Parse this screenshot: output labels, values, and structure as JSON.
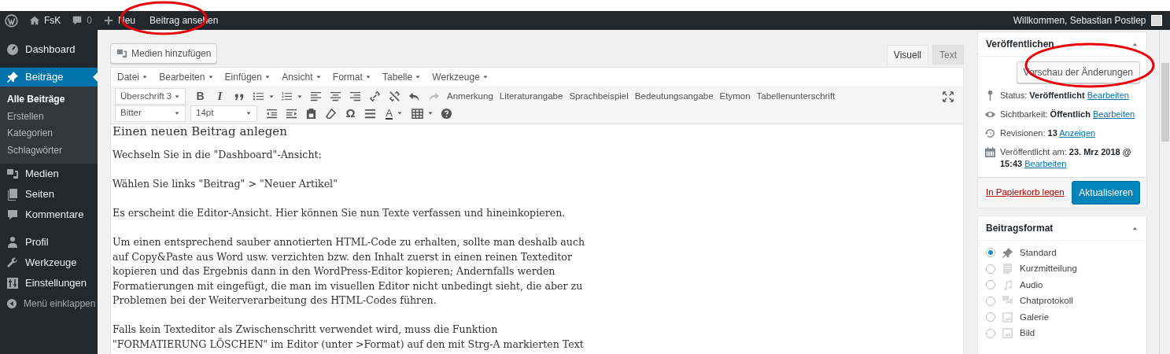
{
  "admin_bar": {
    "items": [
      {
        "kind": "logo"
      },
      {
        "kind": "site",
        "label": "FsK"
      },
      {
        "kind": "comments",
        "label": "0"
      },
      {
        "kind": "new",
        "label": "Neu"
      },
      {
        "kind": "view",
        "label": "Beitrag ansehen"
      }
    ],
    "greeting": "Willkommen, Sebastian Postlep"
  },
  "sidebar": {
    "items": [
      {
        "kind": "dashboard",
        "label": "Dashboard",
        "selected": false
      },
      {
        "kind": "posts",
        "label": "Beiträge",
        "selected": true,
        "children": [
          {
            "label": "Alle Beiträge",
            "selected": true
          },
          {
            "label": "Erstellen",
            "selected": false
          },
          {
            "label": "Kategorien",
            "selected": false
          },
          {
            "label": "Schlagwörter",
            "selected": false
          }
        ]
      },
      {
        "kind": "media",
        "label": "Medien",
        "selected": false
      },
      {
        "kind": "pages",
        "label": "Seiten",
        "selected": false
      },
      {
        "kind": "comments",
        "label": "Kommentare",
        "selected": false
      },
      {
        "kind": "profile",
        "label": "Profil",
        "selected": false
      },
      {
        "kind": "tools",
        "label": "Werkzeuge",
        "selected": false
      },
      {
        "kind": "settings",
        "label": "Einstellungen",
        "selected": false
      }
    ],
    "collapse_label": "Menü einklappen"
  },
  "editor": {
    "add_media_button": "Medien hinzufügen",
    "tabs": [
      {
        "label": "Visuell",
        "selected": true
      },
      {
        "label": "Text",
        "selected": false
      }
    ],
    "menubar": [
      "Datei",
      "Bearbeiten",
      "Einfügen",
      "Ansicht",
      "Format",
      "Tabelle",
      "Werkzeuge"
    ],
    "format_select": "Überschrift 3",
    "font_select": "Bitter",
    "size_select": "14pt",
    "toolbar_1": [
      {
        "kind": "bold",
        "label": "B"
      },
      {
        "kind": "italic",
        "label": "I"
      },
      {
        "kind": "quote"
      },
      {
        "kind": "bullist"
      },
      {
        "kind": "numlist"
      },
      {
        "kind": "alignleft"
      },
      {
        "kind": "aligncenter"
      },
      {
        "kind": "alignright"
      },
      {
        "kind": "link"
      },
      {
        "kind": "unlink"
      },
      {
        "kind": "undo",
        "disabled": false
      },
      {
        "kind": "redo",
        "disabled": true
      }
    ],
    "custom_buttons": [
      "Anmerkung",
      "Literaturangabe",
      "Sprachbeispiel",
      "Bedeutungsangabe",
      "Etymon",
      "Tabellenunterschrift"
    ],
    "toolbar_2": [
      {
        "kind": "outdent"
      },
      {
        "kind": "indent"
      },
      {
        "kind": "paste"
      },
      {
        "kind": "eraser"
      },
      {
        "kind": "charmap",
        "label": "Ω"
      },
      {
        "kind": "hr"
      },
      {
        "kind": "textcolor",
        "label": "A"
      },
      {
        "kind": "table"
      },
      {
        "kind": "help"
      }
    ],
    "content": {
      "heading": "Einen neuen Beitrag anlegen",
      "paragraphs": [
        {
          "lines": [
            "Wechseln Sie in die \"Dashboard\"-Ansicht:"
          ]
        },
        {
          "lines": [
            "Wählen Sie links \"Beitrag\" > \"Neuer Artikel\""
          ]
        },
        {
          "lines": [
            "Es erscheint die Editor-Ansicht. Hier können Sie nun Texte verfassen und hineinkopieren."
          ]
        },
        {
          "lines": [
            "Um einen entsprechend sauber annotierten HTML-Code zu erhalten, sollte man deshalb auch",
            "auf Copy&Paste aus Word usw. verzichten bzw. den Inhalt zuerst in einen reinen Texteditor",
            "kopieren und das Ergebnis dann in den WordPress-Editor kopieren; Andernfalls werden",
            "Formatierungen mit eingefügt, die man im visuellen Editor nicht unbedingt sieht, die aber zu",
            "Problemen bei der Weiterverarbeitung des HTML-Codes führen."
          ]
        },
        {
          "lines": [
            "Falls kein Texteditor als Zwischenschritt verwendet wird, muss die Funktion",
            "\"FORMATIERUNG LÖSCHEN\" im Editor (unter >Format) auf den mit Strg-A markierten Text"
          ]
        }
      ]
    }
  },
  "publish_box": {
    "title": "Veröffentlichen",
    "expanded": true,
    "preview_button": "Vorschau der Änderungen",
    "rows": [
      {
        "kind": "status",
        "label": "Status:",
        "value": "Veröffentlicht",
        "link": "Bearbeiten"
      },
      {
        "kind": "visibility",
        "label": "Sichtbarkeit:",
        "value": "Öffentlich",
        "link": "Bearbeiten"
      },
      {
        "kind": "revisions",
        "label": "Revisionen:",
        "value": "13",
        "link": "Anzeigen"
      },
      {
        "kind": "published",
        "label": "Veröffentlicht am:",
        "value": "23. Mrz 2018 @ 15:43",
        "link": "Bearbeiten"
      }
    ],
    "trash_link": "In Papierkorb legen",
    "update_button": "Aktualisieren"
  },
  "format_box": {
    "title": "Beitragsformat",
    "expanded": true,
    "options": [
      {
        "kind": "standard",
        "label": "Standard",
        "selected": true
      },
      {
        "kind": "aside",
        "label": "Kurzmitteilung",
        "selected": false
      },
      {
        "kind": "audio",
        "label": "Audio",
        "selected": false
      },
      {
        "kind": "chat",
        "label": "Chatprotokoll",
        "selected": false
      },
      {
        "kind": "gallery",
        "label": "Galerie",
        "selected": false
      },
      {
        "kind": "image",
        "label": "Bild",
        "selected": false
      }
    ]
  }
}
